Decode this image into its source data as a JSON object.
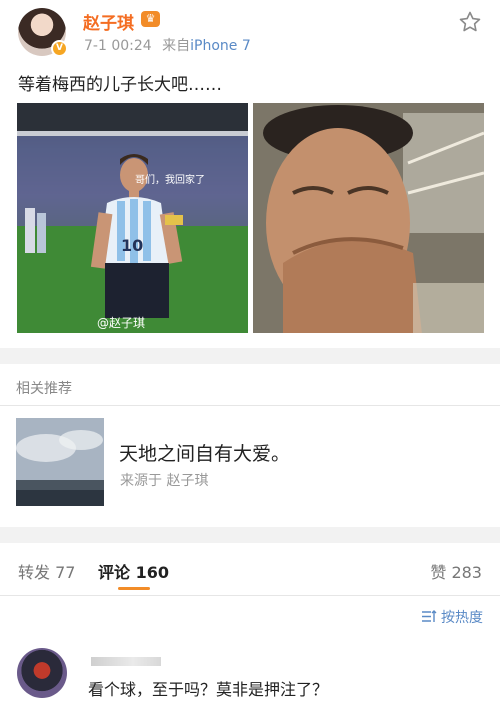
{
  "post": {
    "author": "赵子琪",
    "vip_badge": "♛",
    "date": "7-1 00:24",
    "source_prefix": "来自",
    "source_client": "iPhone 7",
    "text": "等着梅西的儿子长大吧……",
    "image1_watermark": "@赵子琪",
    "image1_subtitle": "哥们，我回家了",
    "image1_jersey_number": "10"
  },
  "related": {
    "section_title": "相关推荐",
    "title": "天地之间自有大爱。",
    "source": "来源于 赵子琪"
  },
  "tabs": {
    "repost": "转发 77",
    "comments": "评论 160",
    "likes": "赞 283"
  },
  "sort_label": "按热度",
  "comment": {
    "text": "看个球，至于吗？莫非是押注了？"
  },
  "colors": {
    "accent_orange": "#f28c28",
    "link_blue": "#5a8ac6",
    "username_orange": "#f46d22"
  },
  "icons": [
    "verified-badge-icon",
    "vip-crown-icon",
    "star-icon",
    "sort-icon"
  ]
}
